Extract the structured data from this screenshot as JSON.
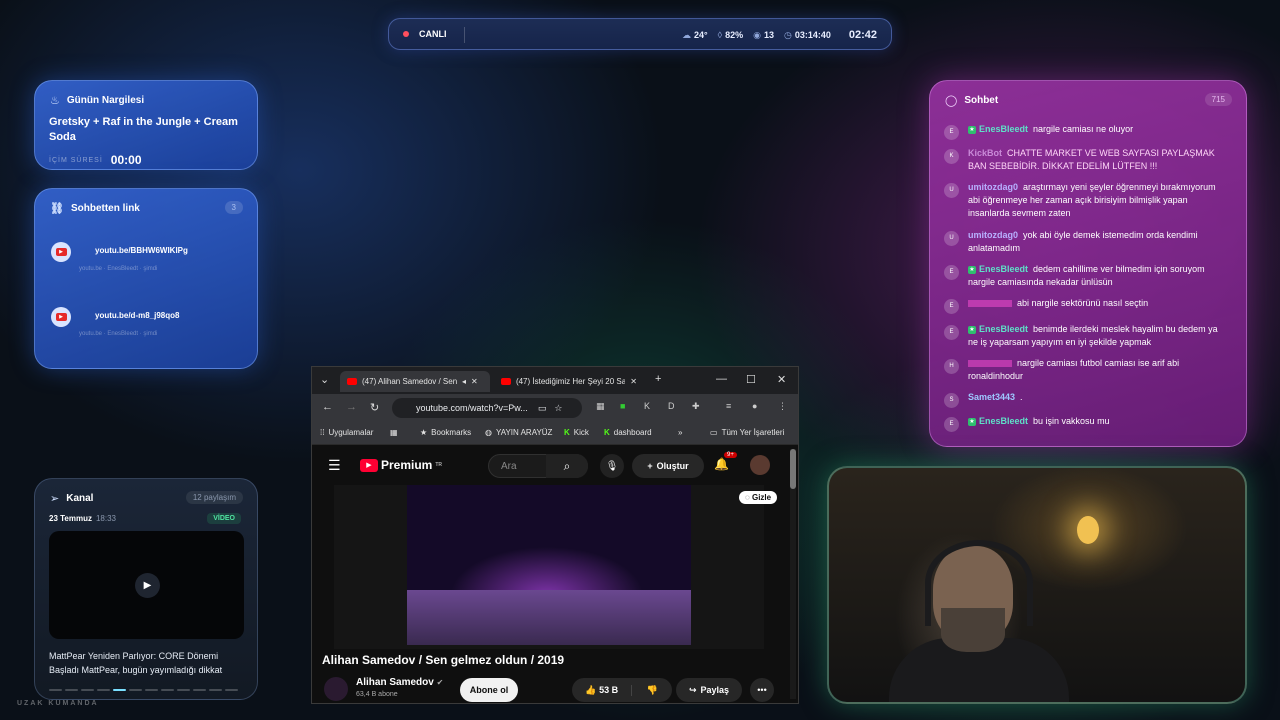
{
  "topbar": {
    "live_label": "CANLI",
    "temperature": "24°",
    "humidity": "82%",
    "viewers": "13",
    "duration": "03:14:40",
    "clock": "02:42"
  },
  "nargile": {
    "title": "Günün Nargilesi",
    "name": "Gretsky + Raf in the Jungle + Cream Soda",
    "timer_label": "İÇİM SÜRESİ",
    "timer_value": "00:00"
  },
  "links": {
    "title": "Sohbetten link",
    "count": "3",
    "items": [
      {
        "url": "youtu.be/BBHW6WIKlPg",
        "meta": "youtu.be · EnesBleedt · şimdi"
      },
      {
        "url": "youtu.be/d-m8_j98qo8",
        "meta": "youtu.be · EnesBleedt · şimdi"
      }
    ]
  },
  "kanal": {
    "title": "Kanal",
    "shares": "12 paylaşım",
    "date": "23 Temmuz",
    "time": "18:33",
    "tag": "VİDEO",
    "desc": "MattPear Yeniden Parlıyor: CORE Dönemi Başladı MattPear, bugün yayımladığı dikkat"
  },
  "remote_label": "UZAK KUMANDA",
  "chat": {
    "title": "Sohbet",
    "count": "715",
    "messages": [
      {
        "initial": "E",
        "user": "EnesBleedt",
        "text": "nargile camiası ne oluyor",
        "color": "#5fe0c8"
      },
      {
        "initial": "K",
        "user": "KickBot",
        "text": "CHATTE MARKET VE WEB SAYFASI PAYLAŞMAK BAN SEBEBİDİR. DİKKAT EDELİM LÜTFEN !!!",
        "color": "#c98ad8"
      },
      {
        "initial": "U",
        "user": "umitozdag0",
        "text": "araştırmayı yeni şeyler öğrenmeyi bırakmıyorum abi öğrenmeye her zaman açık birisiyim bilmişlik yapan insanlarda sevmem zaten",
        "color": "#b8b0ff"
      },
      {
        "initial": "U",
        "user": "umitozdag0",
        "text": "yok abi öyle demek istemedim orda kendimi anlatamadım",
        "color": "#b8b0ff"
      },
      {
        "initial": "E",
        "user": "EnesBleedt",
        "text": "dedem cahillime ver bilmedim için soruyom nargile camiasında nekadar ünlüsün",
        "color": "#5fe0c8"
      },
      {
        "initial": "E",
        "user": "",
        "text": "abi nargile sektörünü nasıl seçtin",
        "color": "#ff4fd8"
      },
      {
        "initial": "E",
        "user": "EnesBleedt",
        "text": "benimde ilerdeki meslek hayalim bu dedem ya ne iş yaparsam yapıyım en iyi şekilde yapmak",
        "color": "#5fe0c8"
      },
      {
        "initial": "H",
        "user": "",
        "text": "nargile camiası futbol camiası ise arif abi ronaldinhodur",
        "color": "#ff4fd8"
      },
      {
        "initial": "S",
        "user": "Samet3443",
        "text": ".",
        "color": "#9ec8ff"
      },
      {
        "initial": "E",
        "user": "EnesBleedt",
        "text": "bu işin vakkosu mu",
        "color": "#5fe0c8"
      }
    ]
  },
  "browser": {
    "tab1": "(47) Alihan Samedov / Sen",
    "tab2": "(47) İstediğimiz Her Şeyi 20 Sa",
    "url": "youtube.com/watch?v=Pw...",
    "bookmarks": [
      "Uygulamalar",
      "Bookmarks",
      "YAYIN ARAYÜZ",
      "Kick",
      "dashboard",
      "Tüm Yer İşaretleri"
    ]
  },
  "youtube": {
    "logo": "Premium",
    "region": "TR",
    "search_placeholder": "Ara",
    "create": "Oluştur",
    "notifications": "9+",
    "hide": "Gizle",
    "title": "Alihan Samedov / Sen gelmez oldun / 2019",
    "channel": "Alihan Samedov",
    "subscribers": "63,4 B abone",
    "subscribe": "Abone ol",
    "likes": "53 B",
    "share": "Paylaş"
  }
}
